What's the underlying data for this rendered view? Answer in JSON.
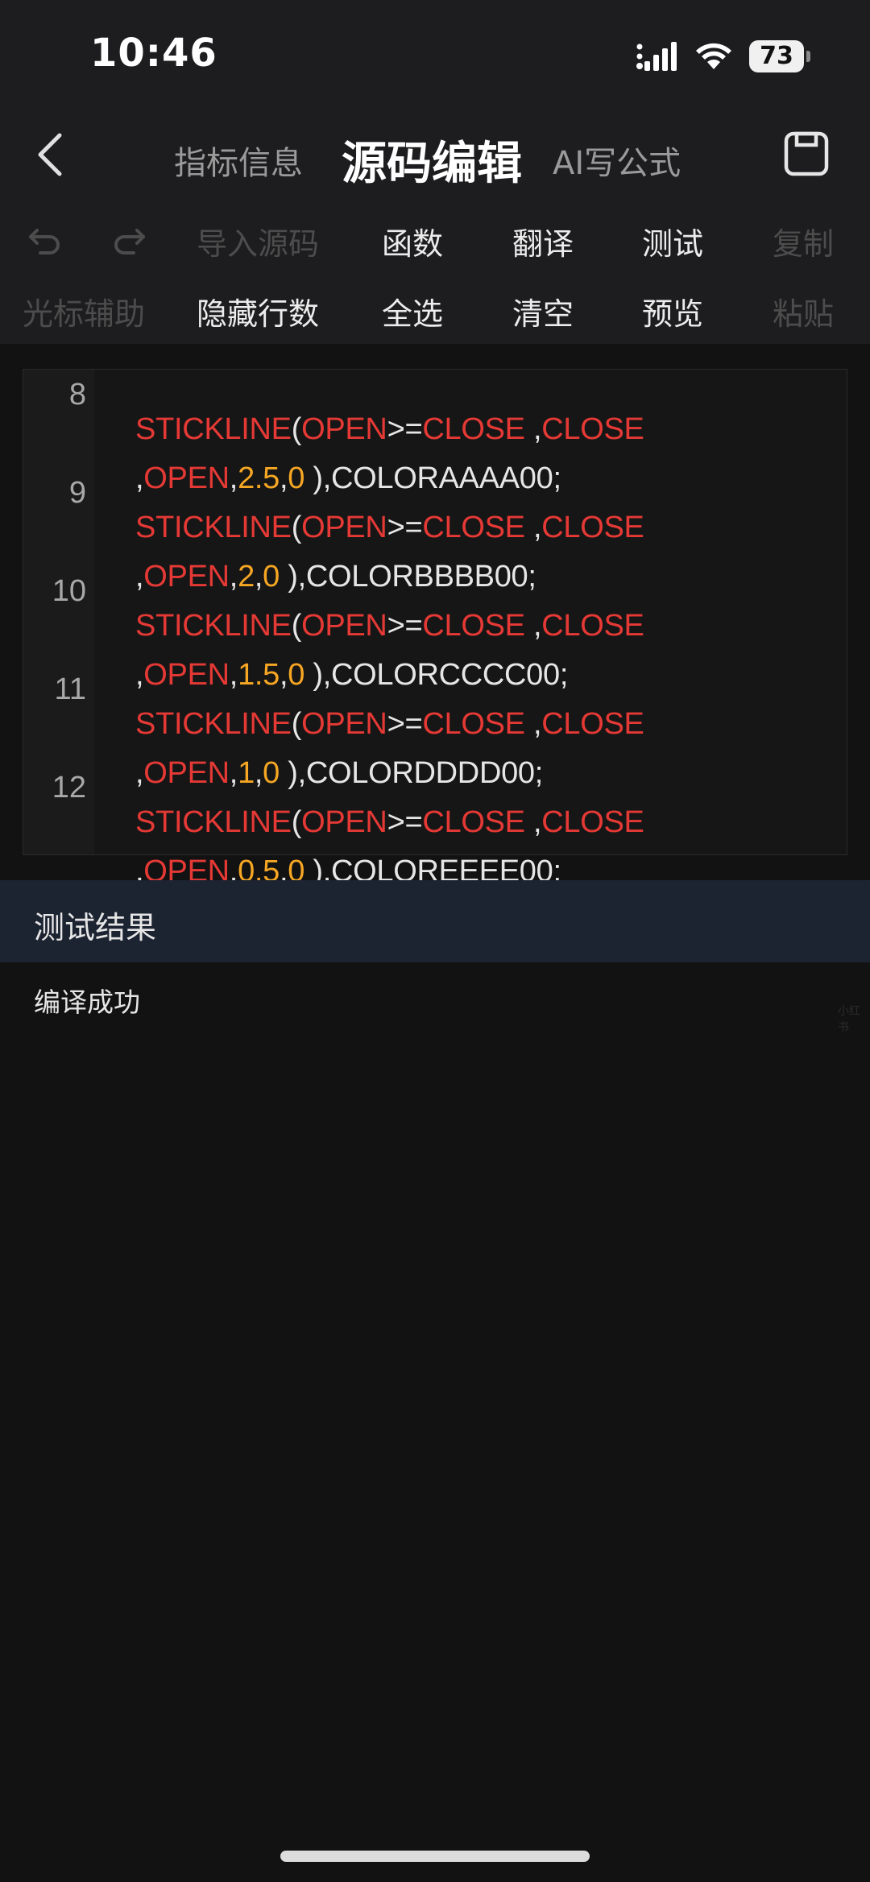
{
  "status_bar": {
    "time": "10:46",
    "battery": "73",
    "icons": [
      "signal-icon",
      "wifi-icon",
      "battery-icon"
    ]
  },
  "nav": {
    "back_icon": "chevron-left-icon",
    "tabs": [
      {
        "label": "指标信息",
        "active": false
      },
      {
        "label": "源码编辑",
        "active": true
      },
      {
        "label": "AI写公式",
        "active": false
      }
    ],
    "save_icon": "save-icon"
  },
  "toolbar": {
    "row1": {
      "undo_icon": "undo-icon",
      "redo_icon": "redo-icon",
      "import": "导入源码",
      "functions": "函数",
      "translate": "翻译",
      "test": "测试",
      "copy": "复制"
    },
    "row2": {
      "cursor_assist": "光标辅助",
      "hide_line_numbers": "隐藏行数",
      "select_all": "全选",
      "clear": "清空",
      "preview": "预览",
      "paste": "粘贴"
    }
  },
  "code": {
    "lines": [
      {
        "num": "8",
        "row1": [
          "STICKLINE",
          "(",
          "OPEN",
          ">=",
          "CLOSE",
          " ,",
          "CLOSE"
        ],
        "row2": [
          ",",
          "OPEN",
          ",",
          "2.5",
          ",",
          "0",
          " ),COLORAAAA00;"
        ]
      },
      {
        "num": "9",
        "row1": [
          "STICKLINE",
          "(",
          "OPEN",
          ">=",
          "CLOSE",
          " ,",
          "CLOSE"
        ],
        "row2": [
          ",",
          "OPEN",
          ",",
          "2",
          ",",
          "0",
          " ),COLORBBBB00;"
        ]
      },
      {
        "num": "10",
        "row1": [
          "STICKLINE",
          "(",
          "OPEN",
          ">=",
          "CLOSE",
          " ,",
          "CLOSE"
        ],
        "row2": [
          ",",
          "OPEN",
          ",",
          "1.5",
          ",",
          "0",
          " ),COLORCCCC00;"
        ]
      },
      {
        "num": "11",
        "row1": [
          "STICKLINE",
          "(",
          "OPEN",
          ">=",
          "CLOSE",
          " ,",
          "CLOSE"
        ],
        "row2": [
          ",",
          "OPEN",
          ",",
          "1",
          ",",
          "0",
          " ),COLORDDDD00;"
        ]
      },
      {
        "num": "12",
        "row1": [
          "STICKLINE",
          "(",
          "OPEN",
          ">=",
          "CLOSE",
          " ,",
          "CLOSE"
        ],
        "row2": [
          ",",
          "OPEN",
          ",",
          "0.5",
          ",",
          "0",
          " ),COLOREEEE00;"
        ]
      }
    ],
    "colors": {
      "keyword": "#e53935",
      "number": "#f5a623",
      "plain": "#e6e6e6"
    }
  },
  "result": {
    "title": "测试结果",
    "message": "编译成功"
  },
  "watermark": "小红书"
}
